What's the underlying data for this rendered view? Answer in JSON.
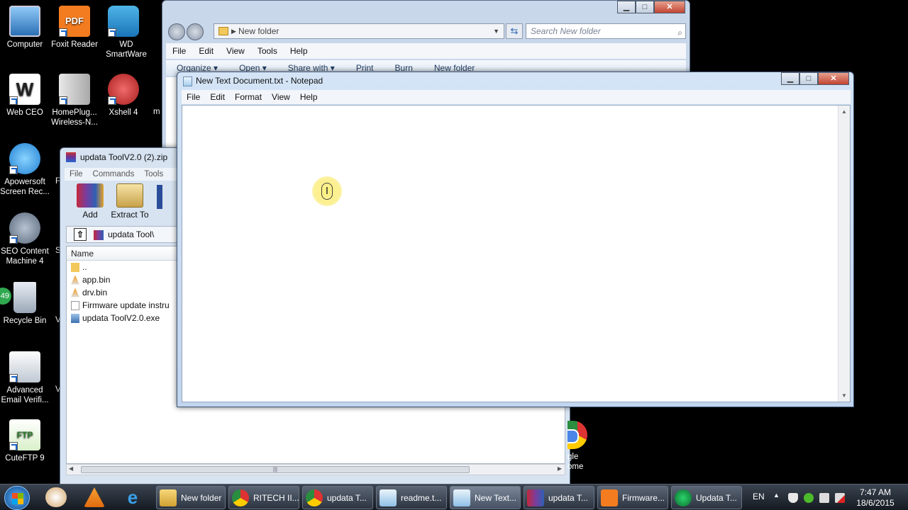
{
  "desktop": {
    "icons": [
      {
        "label": "Computer",
        "icon": "computer-icon"
      },
      {
        "label": "Foxit Reader",
        "icon": "foxit-pdf-icon"
      },
      {
        "label": "WD SmartWare",
        "icon": "wd-smartware-icon"
      },
      {
        "label": "Web CEO",
        "icon": "web-ceo-icon"
      },
      {
        "label": "HomePlug... Wireless-N...",
        "icon": "homeplug-icon"
      },
      {
        "label": "Xshell 4",
        "icon": "xshell-icon"
      },
      {
        "label": "Apowersoft Screen Rec...",
        "icon": "apowersoft-icon"
      },
      {
        "label": "SEO Content Machine 4",
        "icon": "seo-gears-icon"
      },
      {
        "label": "Recycle Bin",
        "icon": "recycle-bin-icon"
      },
      {
        "label": "Advanced Email Verifi...",
        "icon": "email-verifier-icon"
      },
      {
        "label": "CuteFTP 9",
        "icon": "cuteftp-icon"
      }
    ],
    "partial_labels": {
      "x_shell_frag": "m",
      "apower_frag": "F",
      "seo_frag": "S",
      "recycle_frag": "V",
      "email_frag": "V",
      "badge": "49",
      "chrome_frag_line1": "gle",
      "chrome_frag_line2": "ome"
    }
  },
  "explorer": {
    "address": "New folder",
    "search_placeholder": "Search New folder",
    "menu": [
      "File",
      "Edit",
      "View",
      "Tools",
      "Help"
    ],
    "commands": [
      "Organize ▾",
      "Open ▾",
      "Share with ▾",
      "Print",
      "Burn",
      "New folder"
    ]
  },
  "winrar": {
    "title": "updata ToolV2.0 (2).zip",
    "menu": [
      "File",
      "Commands",
      "Tools"
    ],
    "tools": [
      {
        "label": "Add"
      },
      {
        "label": "Extract To"
      }
    ],
    "path": "updata Tool\\",
    "column_name": "Name",
    "files": [
      {
        "name": "..",
        "type": "folder"
      },
      {
        "name": "app.bin",
        "type": "bin"
      },
      {
        "name": "drv.bin",
        "type": "bin"
      },
      {
        "name": "Firmware update instru",
        "type": "pdf"
      },
      {
        "name": "updata ToolV2.0.exe",
        "type": "exe"
      }
    ]
  },
  "notepad": {
    "title": "New Text Document.txt - Notepad",
    "menu": [
      "File",
      "Edit",
      "Format",
      "View",
      "Help"
    ],
    "content": ""
  },
  "taskbar": {
    "tasks": [
      {
        "label": "New folder",
        "icon": "folder-icon"
      },
      {
        "label": "RITECH II...",
        "icon": "chrome-icon"
      },
      {
        "label": "updata T...",
        "icon": "chrome-icon"
      },
      {
        "label": "readme.t...",
        "icon": "notepad-icon"
      },
      {
        "label": "New Text...",
        "icon": "notepad-icon"
      },
      {
        "label": "updata T...",
        "icon": "winrar-icon"
      },
      {
        "label": "Firmware...",
        "icon": "foxit-pdf-icon"
      },
      {
        "label": "Updata T...",
        "icon": "app-icon"
      }
    ],
    "language": "EN",
    "time": "7:47 AM",
    "date": "18/6/2015"
  },
  "colors": {
    "desktop_bg": "#000000",
    "window_frame": "#c2d5ee",
    "taskbar_bg": "#1f252e",
    "highlight_cursor": "#f7e35a"
  }
}
